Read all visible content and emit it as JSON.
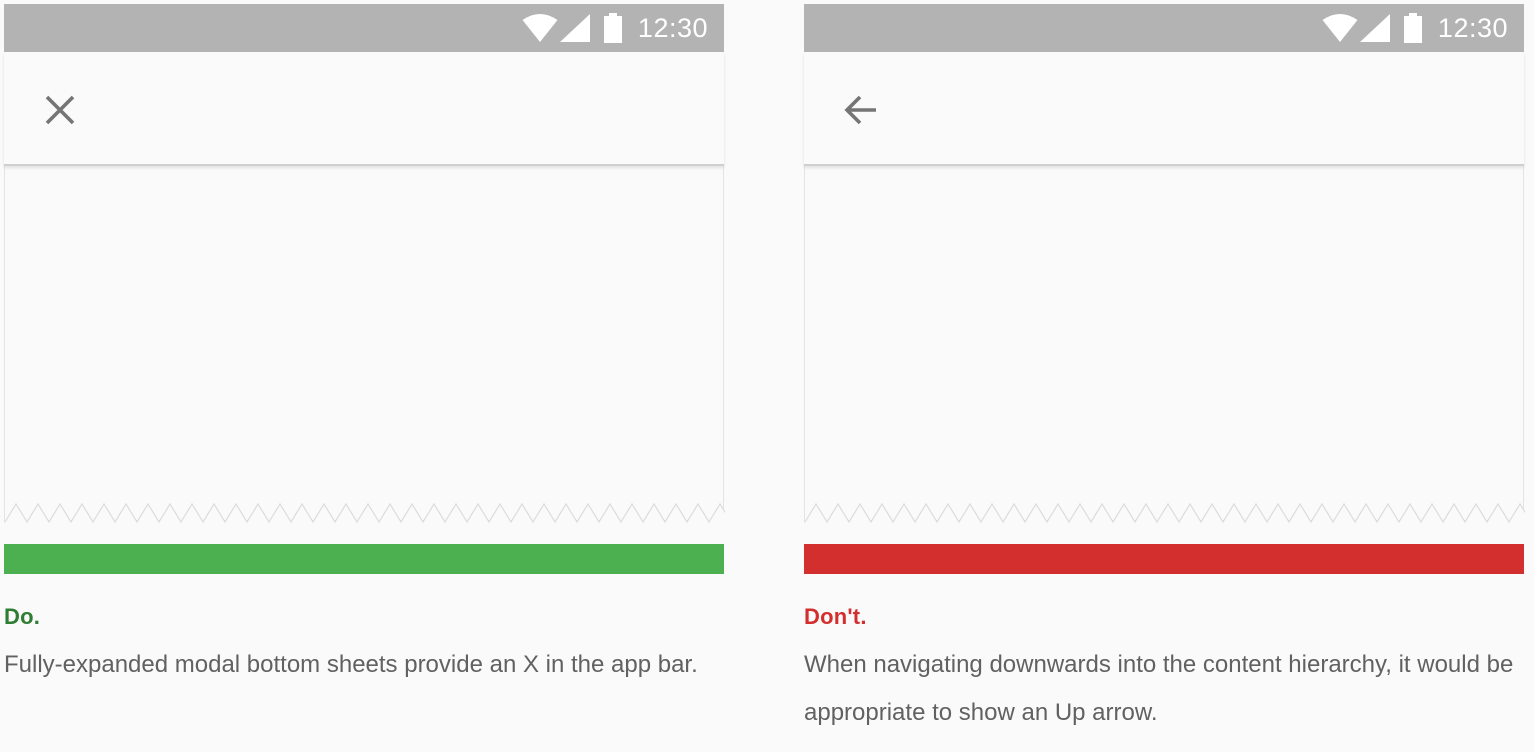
{
  "panels": [
    {
      "status_time": "12:30",
      "nav_icon": "close-icon",
      "indicator_color": "#4caf50",
      "heading": "Do.",
      "heading_color": "#2e7d32",
      "body": "Fully-expanded modal bottom sheets provide an X in the app bar."
    },
    {
      "status_time": "12:30",
      "nav_icon": "arrow-back-icon",
      "indicator_color": "#d32f2f",
      "heading": "Don't.",
      "heading_color": "#d32f2f",
      "body": "When navigating downwards into the content hierarchy, it would be appropriate to show an Up arrow."
    }
  ],
  "colors": {
    "status_bar": "#b3b3b3",
    "surface": "#fafafa",
    "icon": "#757575",
    "body_text": "#616161"
  }
}
